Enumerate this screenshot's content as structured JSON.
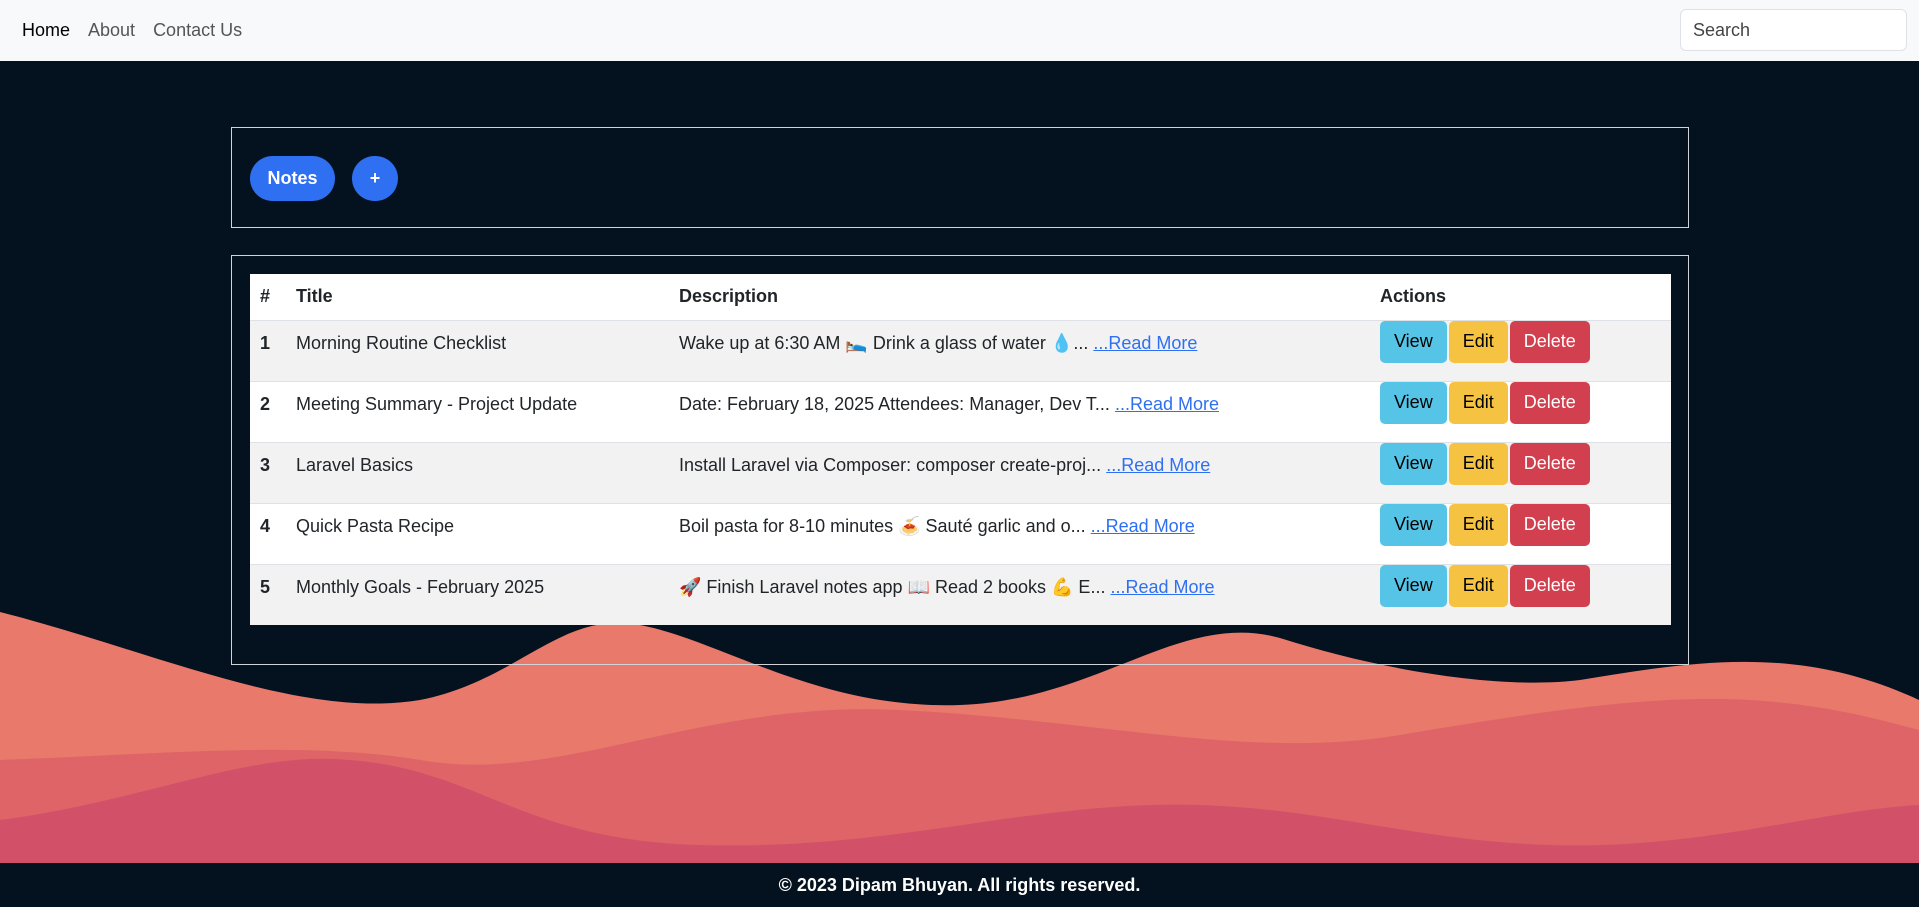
{
  "nav": {
    "links": [
      {
        "label": "Home"
      },
      {
        "label": "About"
      },
      {
        "label": "Contact Us"
      }
    ],
    "search_placeholder": "Search"
  },
  "toolbar": {
    "notes_label": "Notes",
    "add_label": "+"
  },
  "table": {
    "headers": {
      "num": "#",
      "title": "Title",
      "description": "Description",
      "actions": "Actions"
    },
    "read_more": "...Read More",
    "buttons": {
      "view": "View",
      "edit": "Edit",
      "delete": "Delete"
    },
    "rows": [
      {
        "num": "1",
        "title": "Morning Routine Checklist",
        "description": "Wake up at 6:30 AM 🛌 Drink a glass of water 💧..."
      },
      {
        "num": "2",
        "title": "Meeting Summary - Project Update",
        "description": "Date: February 18, 2025 Attendees: Manager, Dev T..."
      },
      {
        "num": "3",
        "title": "Laravel Basics",
        "description": "Install Laravel via Composer: composer create-proj..."
      },
      {
        "num": "4",
        "title": "Quick Pasta Recipe",
        "description": "Boil pasta for 8-10 minutes 🍝 Sauté garlic and o..."
      },
      {
        "num": "5",
        "title": "Monthly Goals - February 2025",
        "description": "🚀 Finish Laravel notes app 📖 Read 2 books 💪 E..."
      }
    ]
  },
  "footer": {
    "text": "© 2023 Dipam Bhuyan. All rights reserved."
  },
  "colors": {
    "background": "#04111f",
    "primary": "#2f6ff2",
    "view": "#56c4e6",
    "edit": "#f5c242",
    "delete": "#d2404f",
    "wave_1": "#e8796b",
    "wave_2": "#de6468",
    "wave_3": "#d25168"
  }
}
